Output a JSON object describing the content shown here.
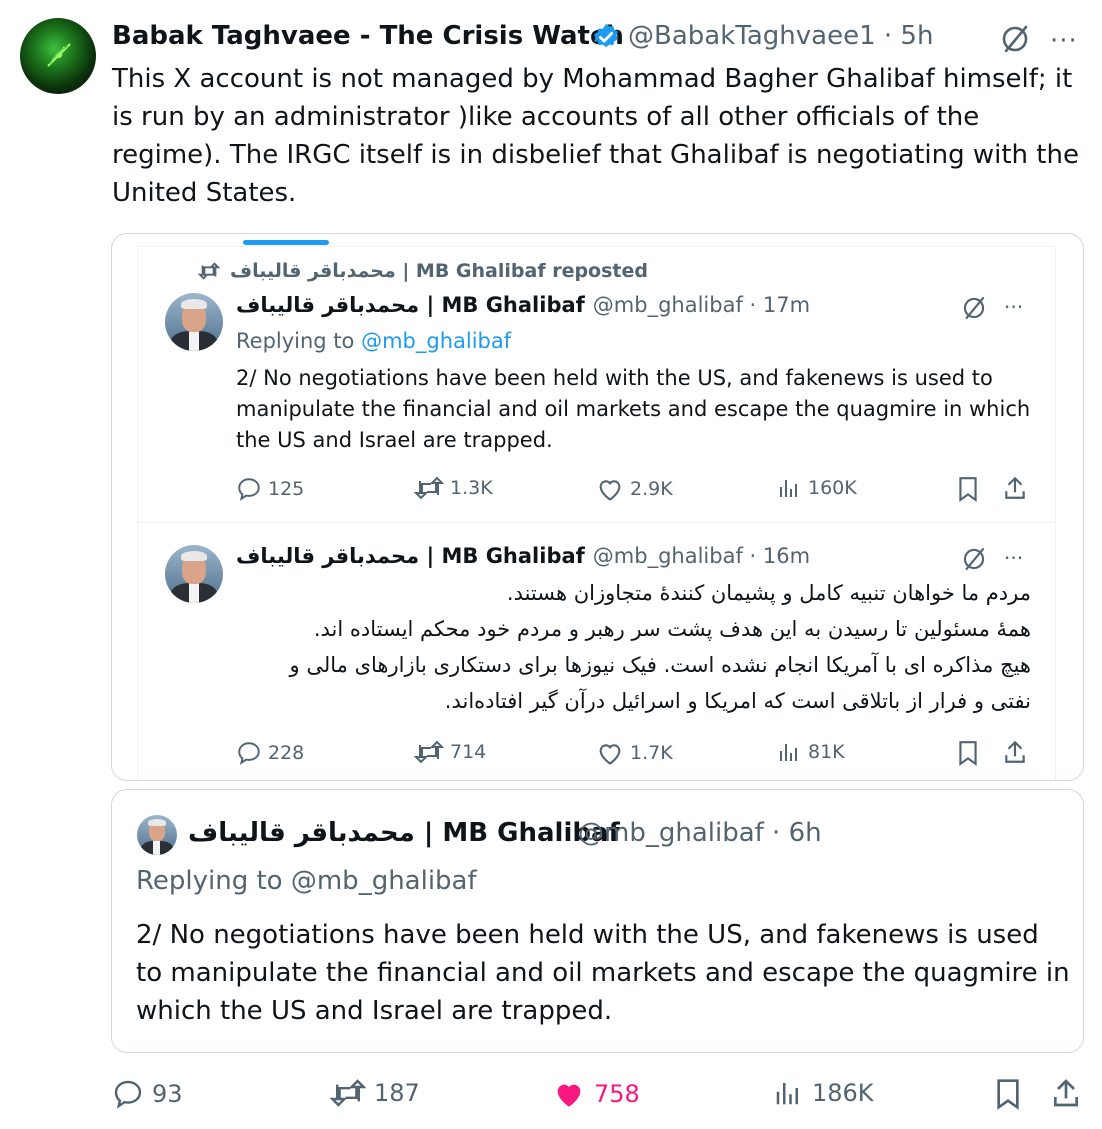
{
  "tweet": {
    "author_name": "Babak Taghvaee - The Crisis Watch",
    "handle": "@BabakTaghvaee1",
    "time": "5h",
    "text": "This X account is not managed by Mohammad Bagher Ghalibaf himself; it is run by an administrator )like accounts of all other officials of the regime). The IRGC itself is in disbelief that Ghalibaf is negotiating with the United States.",
    "more_label": "···"
  },
  "embedded": {
    "repost_label": "محمدباقر قالیباف | MB Ghalibaf reposted",
    "post1": {
      "name": "محمدباقر قالیباف | MB Ghalibaf",
      "handle": "@mb_ghalibaf",
      "time": "17m",
      "replying_prefix": "Replying to",
      "replying_handle": "@mb_ghalibaf",
      "text": "2/ No negotiations have been held with the US, and fakenews is used to manipulate the financial and oil markets and escape the quagmire in which the US and Israel are trapped.",
      "replies": "125",
      "reposts": "1.3K",
      "likes": "2.9K",
      "views": "160K"
    },
    "post2": {
      "name": "محمدباقر قالیباف | MB Ghalibaf",
      "handle": "@mb_ghalibaf",
      "time": "16m",
      "lines": [
        "مردم ما خواهان تنبیه کامل و پشیمان کنندهٔ متجاوزان هستند.",
        "همهٔ مسئولین تا رسیدن به این هدف پشت سر رهبر و مردم خود محکم ایستاده اند.",
        "هیچ مذاکره ای با آمریکا انجام نشده است. فیک نیوزها برای دستکاری بازارهای مالی و",
        "نفتی و فرار از باتلاقی است که امریکا و اسرائیل درآن گیر افتاده‌اند."
      ],
      "replies": "228",
      "reposts": "714",
      "likes": "1.7K",
      "views": "81K"
    }
  },
  "quote": {
    "name": "محمدباقر قالیباف | MB Ghalibaf",
    "handle": "@mb_ghalibaf",
    "time": "6h",
    "replying_prefix": "Replying to",
    "replying_handle": "@mb_ghalibaf",
    "text": "2/ No negotiations have been held with the US, and fakenews is used to manipulate the financial and oil markets and escape the quagmire in which the US and Israel are trapped."
  },
  "actions": {
    "replies": "93",
    "reposts": "187",
    "likes": "758",
    "views": "186K"
  },
  "colors": {
    "accent": "#1d9bf0",
    "like": "#f91880",
    "muted": "#536471"
  }
}
